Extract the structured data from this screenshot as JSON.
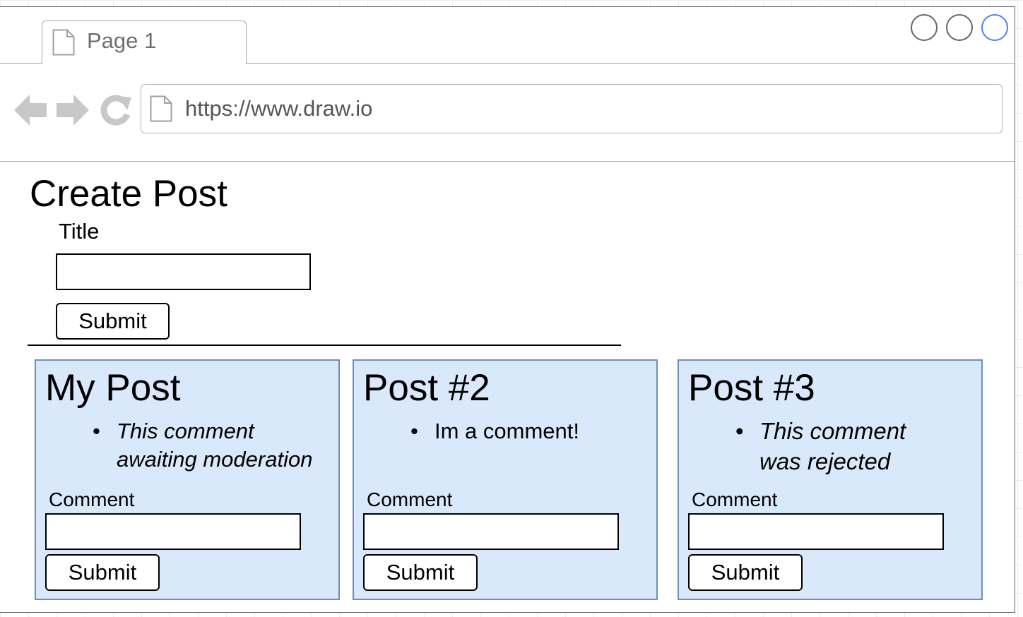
{
  "browser": {
    "tab_label": "Page 1",
    "url": "https://www.draw.io",
    "window_buttons": [
      "minimize-button",
      "maximize-button",
      "close-button"
    ],
    "accent_color": "#4a86e8"
  },
  "create_post": {
    "heading": "Create Post",
    "title_label": "Title",
    "title_value": "",
    "submit_label": "Submit"
  },
  "posts": [
    {
      "title": "My Post",
      "comments": [
        {
          "text": "This comment awaiting moderation",
          "status": "pending",
          "italic": true
        }
      ],
      "comment_label": "Comment",
      "comment_value": "",
      "submit_label": "Submit"
    },
    {
      "title": "Post #2",
      "comments": [
        {
          "text": "Im a comment!",
          "status": "approved",
          "italic": false
        }
      ],
      "comment_label": "Comment",
      "comment_value": "",
      "submit_label": "Submit"
    },
    {
      "title": "Post #3",
      "comments": [
        {
          "text": "This comment was rejected",
          "status": "rejected",
          "italic": true
        }
      ],
      "comment_label": "Comment",
      "comment_value": "",
      "submit_label": "Submit"
    }
  ],
  "colors": {
    "card_fill": "#dae8fc",
    "card_border": "#6c8ebf",
    "chrome_gray": "#c8c8c8"
  },
  "icons": [
    "page-icon",
    "back-arrow-icon",
    "forward-arrow-icon",
    "reload-icon"
  ]
}
